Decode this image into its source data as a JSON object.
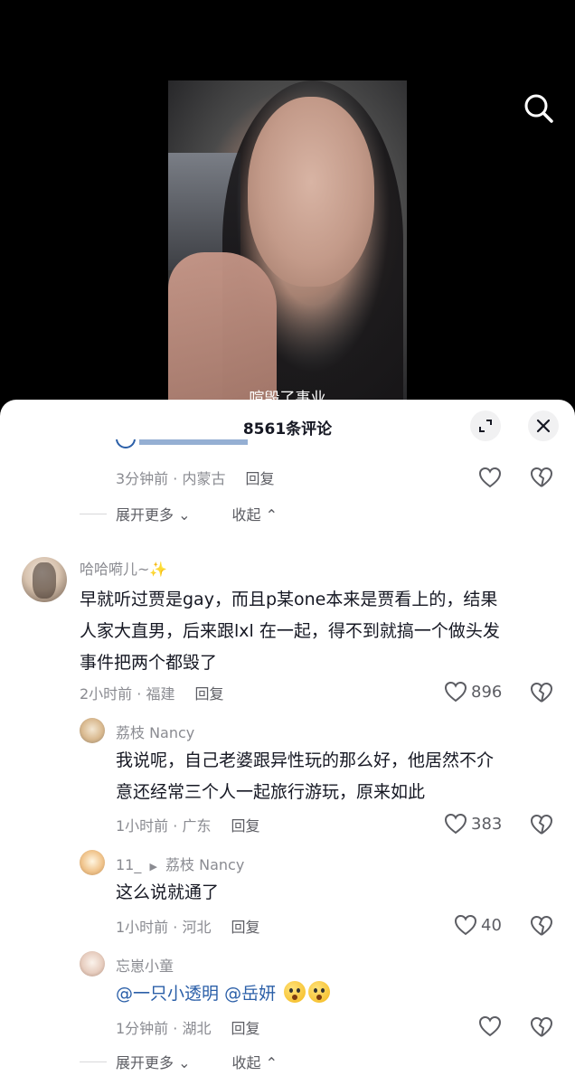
{
  "video": {
    "subtitle": "喧毁了事业"
  },
  "sheet": {
    "title": "8561条评论"
  },
  "partial_comment": {
    "time_location": "3分钟前 · 内蒙古",
    "reply": "回复"
  },
  "thread1_controls": {
    "expand_more": "展开更多",
    "collapse": "收起"
  },
  "comments": [
    {
      "username": "哈哈嗬儿~✨",
      "text_line1": "早就听过贾是gay，而且p某one本来是贾看上的，结果",
      "text_line2": "人家大直男，后来跟lxl 在一起，得不到就搞一个做头发",
      "text_line3": "事件把两个都毁了",
      "time_location": "2小时前 · 福建",
      "reply": "回复",
      "likes": "896"
    }
  ],
  "replies": [
    {
      "username": "荔枝 Nancy",
      "text_line1": "我说呢，自己老婆跟异性玩的那么好，他居然不介",
      "text_line2": "意还经常三个人一起旅行游玩，原来如此",
      "time_location": "1小时前 · 广东",
      "reply": "回复",
      "likes": "383"
    },
    {
      "username": "11_",
      "reply_to": "荔枝 Nancy",
      "text": "这么说就通了",
      "time_location": "1小时前 · 河北",
      "reply": "回复",
      "likes": "40"
    },
    {
      "username": "忘崽小童",
      "mention1": "@一只小透明",
      "mention2": "@岳妍",
      "time_location": "1分钟前 · 湖北",
      "reply": "回复"
    }
  ],
  "thread2_controls": {
    "expand_more": "展开更多",
    "collapse": "收起"
  }
}
